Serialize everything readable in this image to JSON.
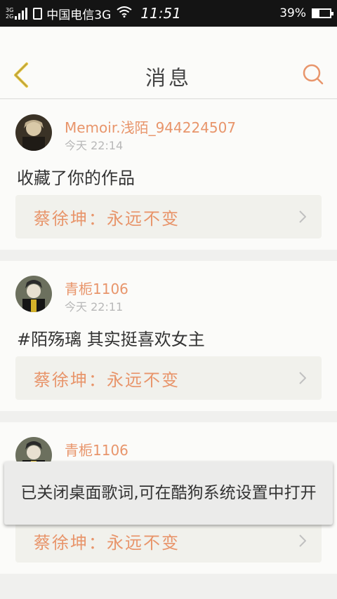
{
  "status_bar": {
    "net_top": "3G",
    "net_bottom": "2G",
    "carrier": "中国电信3G",
    "time": "11:51",
    "battery_text": "39%",
    "battery_level": 0.39
  },
  "header": {
    "title": "消息"
  },
  "messages": [
    {
      "username": "Memoir.浅陌_944224507",
      "time": "今天 22:14",
      "content": "收藏了你的作品",
      "reference": "蔡徐坤：永远不变"
    },
    {
      "username": "青栀1106",
      "time": "今天 22:11",
      "content": "#陌殇璃 其实挺喜欢女主",
      "reference": "蔡徐坤：永远不变"
    },
    {
      "username": "青栀1106",
      "time": "",
      "content": "",
      "reference": "蔡徐坤：永远不变"
    }
  ],
  "toast": {
    "text": "已关闭桌面歌词,可在酷狗系统设置中打开"
  },
  "colors": {
    "accent": "#e8956b",
    "back_arrow": "#e6c43a"
  },
  "icons": [
    "back-arrow-icon",
    "search-icon",
    "chevron-right-icon",
    "wifi-icon",
    "battery-icon",
    "signal-icon",
    "sim-icon"
  ]
}
